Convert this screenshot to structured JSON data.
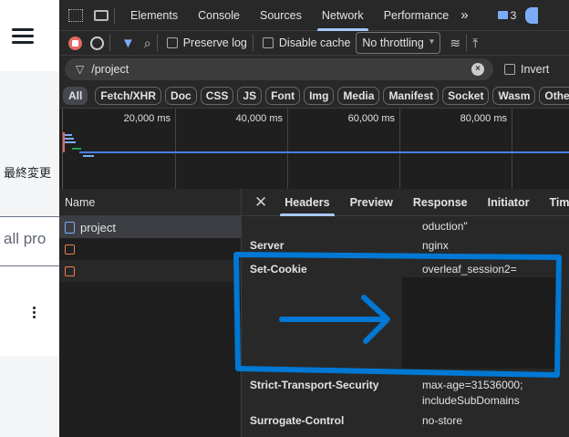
{
  "left_panel": {
    "column_label": "最終変更",
    "search_text": "all pro"
  },
  "devtools": {
    "tabs": [
      "Elements",
      "Console",
      "Sources",
      "Network",
      "Performance"
    ],
    "active_tab": "Network",
    "more_tabs": "»",
    "issues_count": "3",
    "toolbar": {
      "preserve_log": "Preserve log",
      "disable_cache": "Disable cache",
      "throttling": "No throttling"
    },
    "filter": {
      "value": "/project",
      "invert": "Invert"
    },
    "type_chips": [
      "All",
      "Fetch/XHR",
      "Doc",
      "CSS",
      "JS",
      "Font",
      "Img",
      "Media",
      "Manifest",
      "Socket",
      "Wasm",
      "Other"
    ],
    "timeline_ticks": [
      "20,000 ms",
      "40,000 ms",
      "60,000 ms",
      "80,000 ms"
    ],
    "name_column": "Name",
    "requests": [
      {
        "name": "project",
        "type": "document"
      },
      {
        "name": "",
        "type": "script"
      },
      {
        "name": "",
        "type": "script"
      }
    ],
    "detail_tabs": [
      "Headers",
      "Preview",
      "Response",
      "Initiator",
      "Timing"
    ],
    "active_detail_tab": "Headers",
    "headers": [
      {
        "name": "",
        "value": "oduction\""
      },
      {
        "name": "Server",
        "value": "nginx"
      },
      {
        "name": "Set-Cookie",
        "value": "overleaf_session2="
      },
      {
        "name": "Strict-Transport-Security",
        "value": "max-age=31536000;",
        "value2": "includeSubDomains"
      },
      {
        "name": "Surrogate-Control",
        "value": "no-store"
      }
    ],
    "annotation_color": "#0078d4"
  }
}
